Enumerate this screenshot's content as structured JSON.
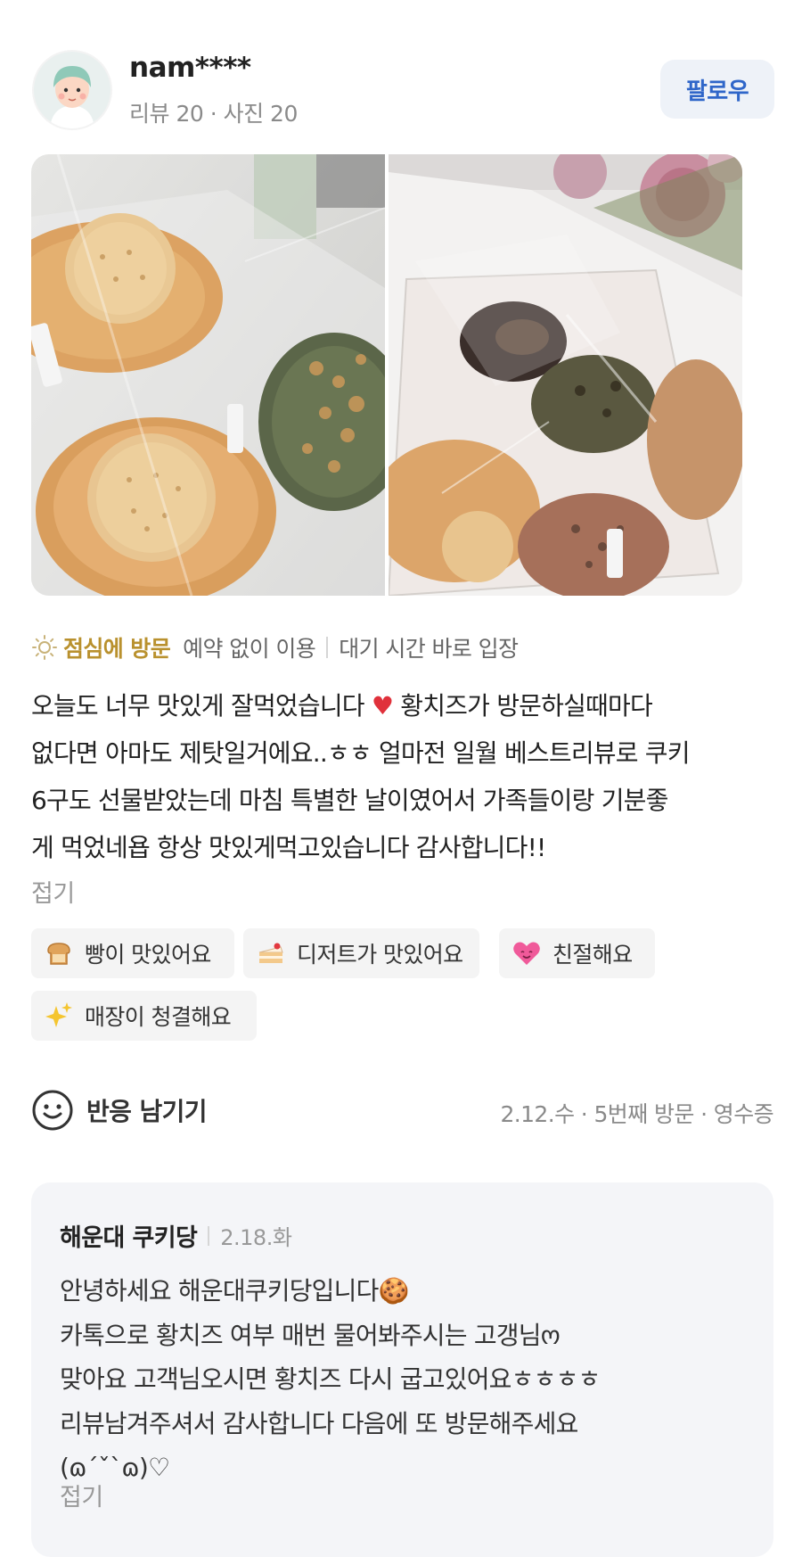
{
  "user": {
    "name": "nam****",
    "stats": "리뷰 20 · 사진 20",
    "follow_label": "팔로우"
  },
  "visit": {
    "time": "점심에 방문",
    "reservation": "예약 없이 이용",
    "wait": "대기 시간 바로 입장"
  },
  "review": {
    "text_before_heart": "오늘도 너무 맛있게 잘먹었습니다 ",
    "heart": "♥",
    "text_after_heart": " 황치즈가 방문하실때마다\n없다면 아마도 제탓일거에요..ㅎㅎ 얼마전 일월 베스트리뷰로 쿠키\n6구도 선물받았는데 마침 특별한 날이였어서 가족들이랑 기분좋\n게 먹었네욥 항상 맛있게먹고있습니다 감사합니다!!",
    "fold_label": "접기"
  },
  "tags": [
    {
      "label": "빵이 맛있어요",
      "icon": "bread-icon"
    },
    {
      "label": "디저트가 맛있어요",
      "icon": "cake-icon"
    },
    {
      "label": "친절해요",
      "icon": "heart-face-icon"
    },
    {
      "label": "매장이 청결해요",
      "icon": "sparkles-icon"
    }
  ],
  "reaction": {
    "label": "반응 남기기",
    "meta": "2.12.수 · 5번째 방문 · 영수증"
  },
  "reply": {
    "owner": "해운대 쿠키당",
    "date": "2.18.화",
    "text": "안녕하세요 해운대쿠키당입니다🍪\n카톡으로 황치즈 여부 매번 물어봐주시는 고갱님ო\n맞아요 고객님오시면 황치즈 다시 굽고있어요ㅎㅎㅎㅎ\n리뷰남겨주셔서 감사합니다 다음에 또 방문해주세요\n(ɷ´ˇ`ɷ)♡",
    "fold_label": "접기"
  },
  "colors": {
    "accent_visit": "#b9912e",
    "follow_text": "#2f66c9",
    "follow_bg": "#eef2f8",
    "reply_bg": "#f4f5f8",
    "tag_bg": "#f4f4f4"
  }
}
